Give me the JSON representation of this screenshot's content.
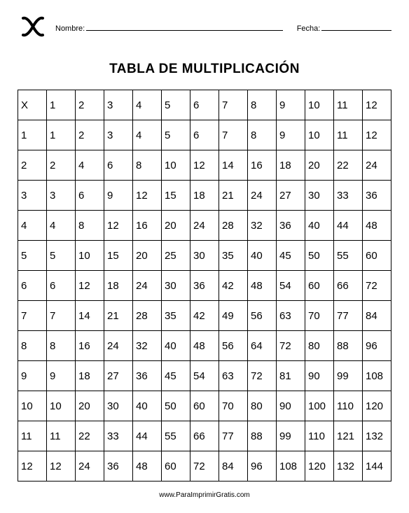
{
  "header": {
    "name_label": "Nombre:",
    "date_label": "Fecha:",
    "name_value": "",
    "date_value": ""
  },
  "title": "TABLA DE MULTIPLICACIÓN",
  "chart_data": {
    "type": "table",
    "corner": "X",
    "col_headers": [
      "1",
      "2",
      "3",
      "4",
      "5",
      "6",
      "7",
      "8",
      "9",
      "10",
      "11",
      "12"
    ],
    "row_headers": [
      "1",
      "2",
      "3",
      "4",
      "5",
      "6",
      "7",
      "8",
      "9",
      "10",
      "11",
      "12"
    ],
    "rows": [
      [
        1,
        2,
        3,
        4,
        5,
        6,
        7,
        8,
        9,
        10,
        11,
        12
      ],
      [
        2,
        4,
        6,
        8,
        10,
        12,
        14,
        16,
        18,
        20,
        22,
        24
      ],
      [
        3,
        6,
        9,
        12,
        15,
        18,
        21,
        24,
        27,
        30,
        33,
        36
      ],
      [
        4,
        8,
        12,
        16,
        20,
        24,
        28,
        32,
        36,
        40,
        44,
        48
      ],
      [
        5,
        10,
        15,
        20,
        25,
        30,
        35,
        40,
        45,
        50,
        55,
        60
      ],
      [
        6,
        12,
        18,
        24,
        30,
        36,
        42,
        48,
        54,
        60,
        66,
        72
      ],
      [
        7,
        14,
        21,
        28,
        35,
        42,
        49,
        56,
        63,
        70,
        77,
        84
      ],
      [
        8,
        16,
        24,
        32,
        40,
        48,
        56,
        64,
        72,
        80,
        88,
        96
      ],
      [
        9,
        18,
        27,
        36,
        45,
        54,
        63,
        72,
        81,
        90,
        99,
        108
      ],
      [
        10,
        20,
        30,
        40,
        50,
        60,
        70,
        80,
        90,
        100,
        110,
        120
      ],
      [
        11,
        22,
        33,
        44,
        55,
        66,
        77,
        88,
        99,
        110,
        121,
        132
      ],
      [
        12,
        24,
        36,
        48,
        60,
        72,
        84,
        96,
        108,
        120,
        132,
        144
      ]
    ]
  },
  "footer": "www.ParaImprimirGratis.com"
}
